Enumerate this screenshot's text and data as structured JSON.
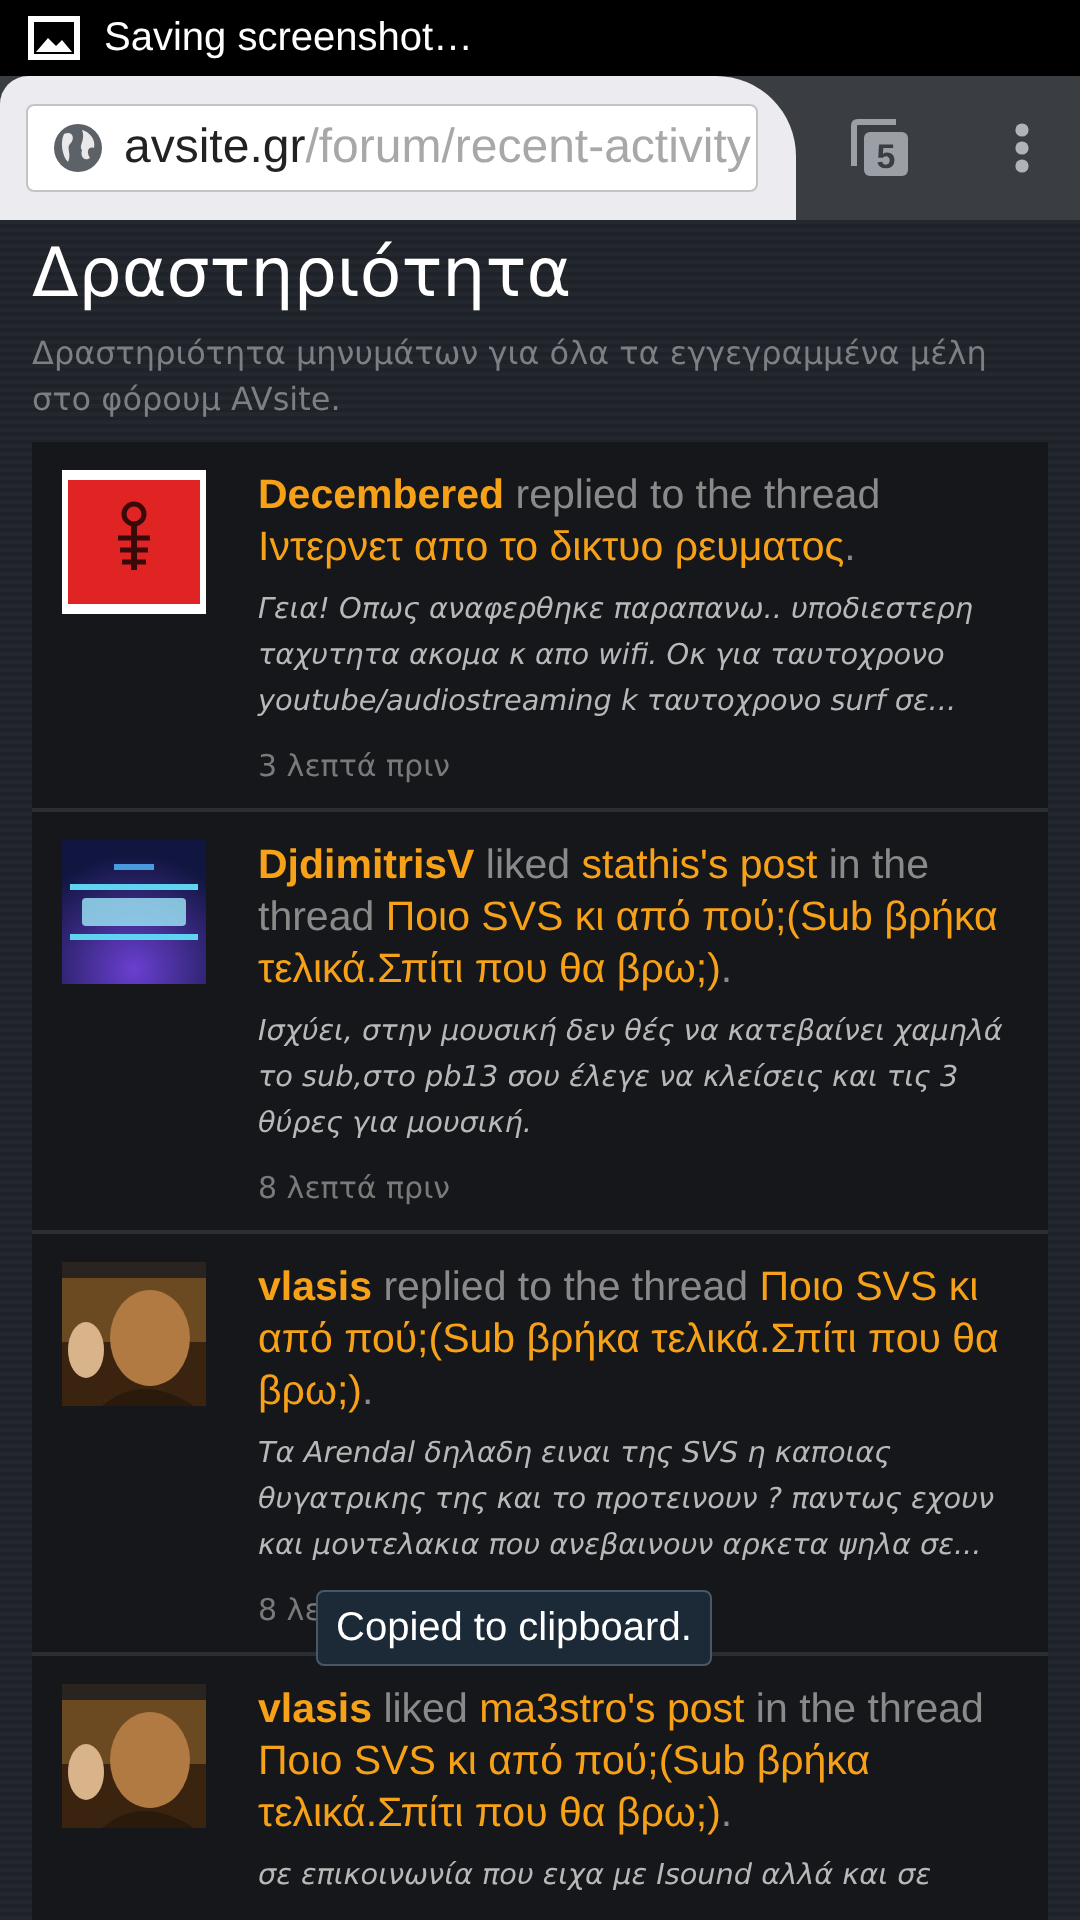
{
  "status_bar": {
    "notification": "Saving screenshot…"
  },
  "browser": {
    "url_host": "avsite.gr",
    "url_path": "/forum/recent-activity",
    "tab_count": "5"
  },
  "page": {
    "title": "Δραστηριότητα",
    "subtitle": "Δραστηριότητα μηνυμάτων για όλα τα εγγεγραμμένα μέλη στο φόρουμ AVsite."
  },
  "activities": [
    {
      "avatar": {
        "kind": "emblem"
      },
      "headline": [
        {
          "kind": "user",
          "text": "Decembered"
        },
        {
          "kind": "plain",
          "text": " replied to the thread "
        },
        {
          "kind": "link",
          "text": "Ιντερνετ απο το δικτυο ρευματος"
        },
        {
          "kind": "plain",
          "text": "."
        }
      ],
      "snippet": "Γεια! Οπως αναφερθηκε παραπανω.. υποδιεστερη ταχυτητα ακομα κ απο wifi. Οκ για ταυτοχρονο youtube/audiostreaming k ταυτοχρονο surf σε...",
      "time": "3 λεπτά πριν"
    },
    {
      "avatar": {
        "kind": "marquee"
      },
      "headline": [
        {
          "kind": "user",
          "text": "DjdimitrisV"
        },
        {
          "kind": "plain",
          "text": " liked "
        },
        {
          "kind": "link",
          "text": "stathis's post"
        },
        {
          "kind": "plain",
          "text": " in the thread "
        },
        {
          "kind": "link",
          "text": "Ποιο SVS κι από πού;(Sub βρήκα τελικά.Σπίτι που θα βρω;)"
        },
        {
          "kind": "plain",
          "text": "."
        }
      ],
      "snippet": "Ισχύει, στην μουσική δεν θές να κατεβαίνει χαμηλά το sub,στο pb13 σου έλεγε να κλείσεις και τις 3 θύρες για μουσική.",
      "time": "8 λεπτά πριν"
    },
    {
      "avatar": {
        "kind": "portrait"
      },
      "headline": [
        {
          "kind": "user",
          "text": "vlasis"
        },
        {
          "kind": "plain",
          "text": " replied to the thread "
        },
        {
          "kind": "link",
          "text": "Ποιο SVS κι από πού;(Sub βρήκα τελικά.Σπίτι που θα βρω;)"
        },
        {
          "kind": "plain",
          "text": "."
        }
      ],
      "snippet": "Τα Arendal δηλαδη ειναι της SVS η καποιας θυγατρικης της και το προτεινουν ? παντως εχουν και μοντελακια που ανεβαινουν αρκετα ψηλα σε...",
      "time": "8 λε"
    },
    {
      "avatar": {
        "kind": "portrait"
      },
      "headline": [
        {
          "kind": "user",
          "text": "vlasis"
        },
        {
          "kind": "plain",
          "text": " liked "
        },
        {
          "kind": "link",
          "text": "ma3stro's post"
        },
        {
          "kind": "plain",
          "text": " in the thread "
        },
        {
          "kind": "link",
          "text": "Ποιο SVS κι από πού;(Sub βρήκα τελικά.Σπίτι που θα βρω;)"
        },
        {
          "kind": "plain",
          "text": "."
        }
      ],
      "snippet": "σε επικοινωνία που ειχα με Isound αλλά και σε"
    }
  ],
  "toast": {
    "text": "Copied to clipboard."
  }
}
